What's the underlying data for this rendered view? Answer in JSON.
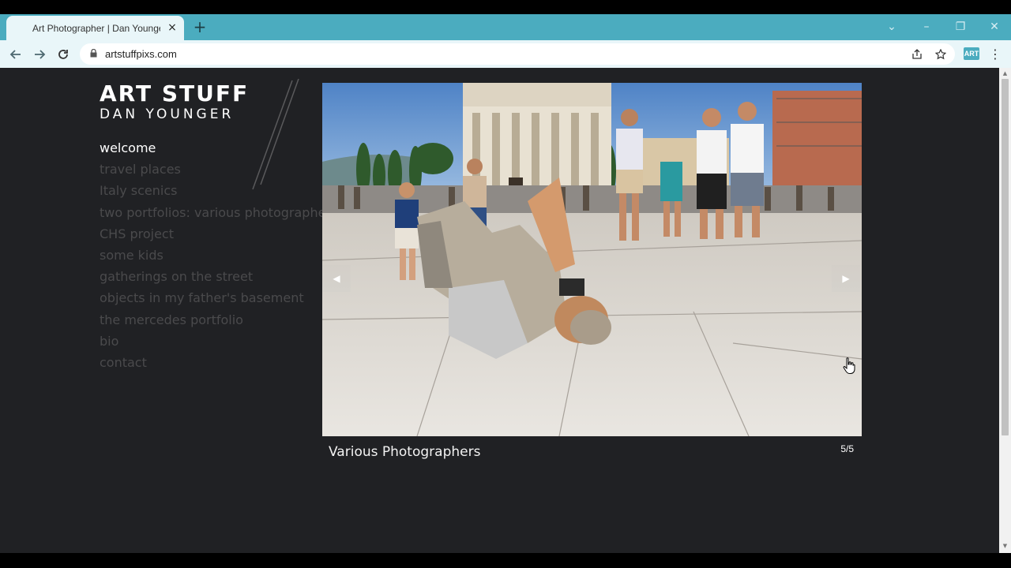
{
  "browser": {
    "tab_title": "Art Photographer | Dan Younger",
    "tab_close_icon": "×",
    "new_tab_icon": "+",
    "url": "artstuffpixs.com",
    "extension_label": "ART",
    "window_controls": [
      "⌄",
      "–",
      "❐",
      "✕"
    ]
  },
  "site": {
    "logo_main": "ART STUFF",
    "logo_sub": "DAN YOUNGER",
    "nav": [
      {
        "label": "welcome",
        "active": true
      },
      {
        "label": "travel places",
        "active": false
      },
      {
        "label": "Italy scenics",
        "active": false
      },
      {
        "label": "two portfolios: various photographers",
        "active": false
      },
      {
        "label": "CHS project",
        "active": false
      },
      {
        "label": "some kids",
        "active": false
      },
      {
        "label": "gatherings on the street",
        "active": false
      },
      {
        "label": "objects in my father's basement",
        "active": false
      },
      {
        "label": "the mercedes portfolio",
        "active": false
      },
      {
        "label": "bio",
        "active": false
      },
      {
        "label": "contact",
        "active": false
      }
    ],
    "slideshow": {
      "caption": "Various Photographers",
      "counter": "5/5",
      "prev_icon": "◀",
      "next_icon": "▶"
    }
  },
  "colors": {
    "tab_strip": "#4bacbf",
    "page_bg": "#202124",
    "nav_active": "#ffffff",
    "nav_inactive": "#4a4a4c"
  }
}
